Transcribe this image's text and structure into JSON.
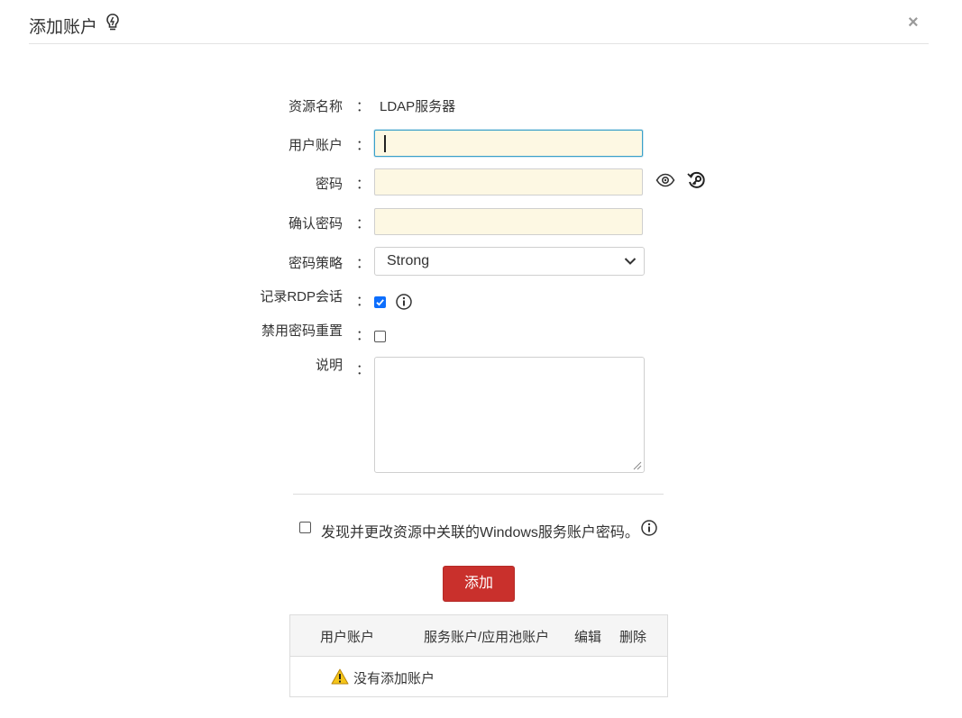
{
  "dialog": {
    "title": "添加账户",
    "close_label": "×"
  },
  "form": {
    "resource_name": {
      "label": "资源名称",
      "colon": "：",
      "value": "LDAP服务器"
    },
    "user_account": {
      "label": "用户账户",
      "colon": "：",
      "value": ""
    },
    "password": {
      "label": "密码",
      "colon": "：",
      "value": ""
    },
    "confirm_password": {
      "label": "确认密码",
      "colon": "：",
      "value": ""
    },
    "password_policy": {
      "label": "密码策略",
      "colon": "：",
      "selected": "Strong"
    },
    "record_rdp": {
      "label": "记录RDP会话",
      "colon": "：",
      "checked": true
    },
    "disable_reset": {
      "label": "禁用密码重置",
      "colon": "：",
      "checked": false
    },
    "description": {
      "label": "说明",
      "colon": "：",
      "value": ""
    }
  },
  "discover": {
    "label": "发现并更改资源中关联的Windows服务账户密码。",
    "checked": false
  },
  "add_button": {
    "label": "添加"
  },
  "accounts_table": {
    "columns": [
      "用户账户",
      "服务账户/应用池账户",
      "编辑",
      "删除"
    ],
    "empty_message": "没有添加账户"
  },
  "colors": {
    "input_bg": "#fdf8e3",
    "primary_button": "#c9302c",
    "checkbox_checked": "#0d6efd",
    "focus_border": "#3aa0c9"
  },
  "icons": {
    "title_icon": "lightbulb-icon",
    "show_password": "eye-icon",
    "generate_password": "key-refresh-icon",
    "info": "info-icon",
    "warning": "warning-icon"
  }
}
